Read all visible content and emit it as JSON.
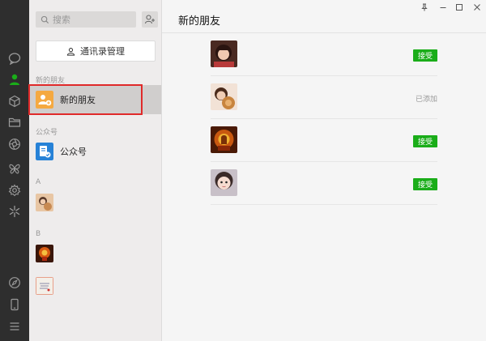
{
  "window": {
    "title": "新的朋友"
  },
  "sidebar_nav": {
    "items": [
      {
        "name": "chat",
        "icon": "chat-bubble-icon",
        "active": false
      },
      {
        "name": "contacts",
        "icon": "person-icon",
        "active": true
      },
      {
        "name": "favorites",
        "icon": "cube-icon",
        "active": false
      },
      {
        "name": "files",
        "icon": "folder-icon",
        "active": false
      },
      {
        "name": "moments",
        "icon": "aperture-icon",
        "active": false
      },
      {
        "name": "mini-programs",
        "icon": "butterfly-icon",
        "active": false
      },
      {
        "name": "settings-plugin",
        "icon": "gear-icon",
        "active": false
      },
      {
        "name": "discover",
        "icon": "sparkle-icon",
        "active": false
      },
      {
        "name": "browser",
        "icon": "compass-icon",
        "active": false
      },
      {
        "name": "phone",
        "icon": "phone-icon",
        "active": false
      },
      {
        "name": "menu",
        "icon": "hamburger-icon",
        "active": false
      }
    ]
  },
  "search": {
    "placeholder": "搜索"
  },
  "contacts": {
    "manage_label": "通讯录管理",
    "section_new_friends": "新的朋友",
    "new_friends_label": "新的朋友",
    "section_official": "公众号",
    "official_label": "公众号",
    "letter_a": "A",
    "letter_b": "B"
  },
  "new_friends": [
    {
      "status": "accept",
      "action_label": "接受"
    },
    {
      "status": "added",
      "action_label": "已添加"
    },
    {
      "status": "accept",
      "action_label": "接受"
    },
    {
      "status": "accept",
      "action_label": "接受"
    }
  ],
  "colors": {
    "accent_green": "#1aad19",
    "nav_bg": "#2e2e2e",
    "highlight_red": "#e02a2a"
  }
}
